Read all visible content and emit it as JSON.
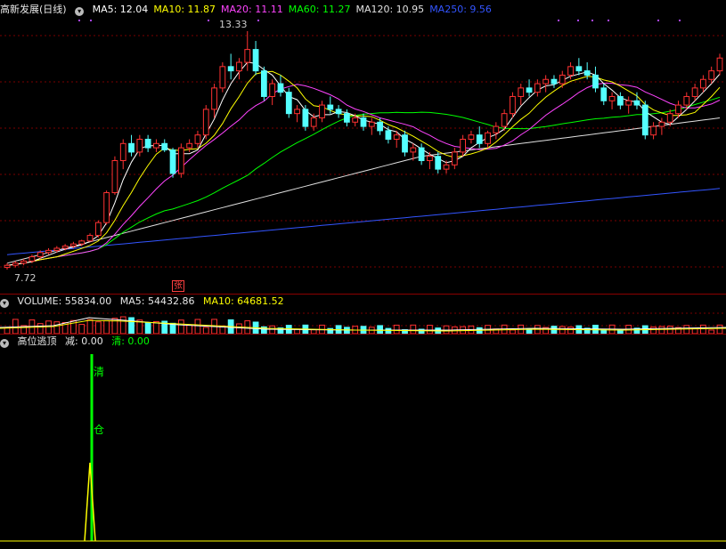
{
  "main": {
    "title": "高新发展(日线)",
    "ma": [
      {
        "label": "MA5: 12.04",
        "color": "#ffffff"
      },
      {
        "label": "MA10: 11.87",
        "color": "#ffff00"
      },
      {
        "label": "MA20: 11.11",
        "color": "#ff44ff"
      },
      {
        "label": "MA60: 11.27",
        "color": "#00ff00"
      },
      {
        "label": "MA120: 10.95",
        "color": "#e0e0e0"
      },
      {
        "label": "MA250: 9.56",
        "color": "#3355ff"
      }
    ],
    "high_label": "13.33",
    "low_label": "7.72",
    "zhang_label": "张"
  },
  "volume": {
    "title": "VOLUME: 55834.00",
    "ma5": "MA5: 54432.86",
    "ma10": "MA10: 64681.52"
  },
  "indicator": {
    "title": "高位逃顶",
    "jian": "减: 0.00",
    "qing": "清: 0.00",
    "qing_char": "清",
    "cang_char": "仓"
  },
  "colors": {
    "up": "#ff3232",
    "down": "#54ffff",
    "separator": "#8b0000"
  },
  "chart_data": {
    "type": "candlestick",
    "price_range": [
      7.72,
      13.33
    ],
    "candles": [
      [
        7.8,
        7.9,
        7.75,
        7.85
      ],
      [
        7.85,
        7.95,
        7.8,
        7.9
      ],
      [
        7.9,
        8.0,
        7.85,
        7.95
      ],
      [
        7.95,
        8.1,
        7.9,
        8.05
      ],
      [
        8.05,
        8.2,
        8.0,
        8.15
      ],
      [
        8.15,
        8.25,
        8.1,
        8.2
      ],
      [
        8.2,
        8.3,
        8.15,
        8.25
      ],
      [
        8.25,
        8.35,
        8.2,
        8.3
      ],
      [
        8.3,
        8.4,
        8.25,
        8.35
      ],
      [
        8.35,
        8.45,
        8.3,
        8.42
      ],
      [
        8.42,
        8.6,
        8.4,
        8.55
      ],
      [
        8.55,
        8.9,
        8.5,
        8.85
      ],
      [
        8.85,
        9.6,
        8.8,
        9.55
      ],
      [
        9.55,
        10.4,
        9.5,
        10.3
      ],
      [
        10.3,
        10.8,
        10.1,
        10.7
      ],
      [
        10.7,
        10.9,
        10.4,
        10.5
      ],
      [
        10.5,
        10.9,
        10.4,
        10.8
      ],
      [
        10.8,
        10.9,
        10.5,
        10.6
      ],
      [
        10.6,
        10.8,
        10.5,
        10.7
      ],
      [
        10.7,
        10.8,
        10.5,
        10.55
      ],
      [
        10.55,
        10.6,
        9.9,
        10.0
      ],
      [
        10.0,
        10.7,
        9.9,
        10.6
      ],
      [
        10.6,
        10.8,
        10.5,
        10.7
      ],
      [
        10.7,
        11.0,
        10.6,
        10.9
      ],
      [
        10.9,
        11.6,
        10.8,
        11.5
      ],
      [
        11.5,
        12.1,
        11.3,
        12.0
      ],
      [
        12.0,
        12.6,
        11.9,
        12.5
      ],
      [
        12.5,
        12.8,
        12.2,
        12.4
      ],
      [
        12.4,
        12.7,
        12.2,
        12.6
      ],
      [
        12.6,
        13.33,
        12.4,
        12.9
      ],
      [
        12.9,
        13.1,
        12.3,
        12.4
      ],
      [
        12.4,
        12.5,
        11.7,
        11.8
      ],
      [
        11.8,
        12.2,
        11.6,
        12.1
      ],
      [
        12.1,
        12.3,
        11.8,
        11.9
      ],
      [
        11.9,
        12.0,
        11.3,
        11.4
      ],
      [
        11.4,
        11.6,
        11.2,
        11.5
      ],
      [
        11.5,
        11.6,
        11.0,
        11.1
      ],
      [
        11.1,
        11.4,
        11.0,
        11.3
      ],
      [
        11.3,
        11.7,
        11.2,
        11.6
      ],
      [
        11.6,
        11.8,
        11.4,
        11.5
      ],
      [
        11.5,
        11.6,
        11.3,
        11.4
      ],
      [
        11.4,
        11.5,
        11.1,
        11.2
      ],
      [
        11.2,
        11.4,
        11.1,
        11.3
      ],
      [
        11.3,
        11.4,
        11.0,
        11.1
      ],
      [
        11.1,
        11.3,
        10.9,
        11.2
      ],
      [
        11.2,
        11.3,
        10.9,
        11.0
      ],
      [
        11.0,
        11.1,
        10.7,
        10.8
      ],
      [
        10.8,
        11.0,
        10.6,
        10.9
      ],
      [
        10.9,
        11.0,
        10.4,
        10.5
      ],
      [
        10.5,
        10.7,
        10.3,
        10.6
      ],
      [
        10.6,
        10.7,
        10.2,
        10.3
      ],
      [
        10.3,
        10.5,
        10.1,
        10.4
      ],
      [
        10.4,
        10.5,
        10.0,
        10.1
      ],
      [
        10.1,
        10.3,
        10.0,
        10.2
      ],
      [
        10.2,
        10.6,
        10.1,
        10.5
      ],
      [
        10.5,
        10.9,
        10.4,
        10.8
      ],
      [
        10.8,
        11.0,
        10.7,
        10.9
      ],
      [
        10.9,
        11.1,
        10.6,
        10.7
      ],
      [
        10.7,
        11.0,
        10.6,
        10.95
      ],
      [
        10.95,
        11.2,
        10.8,
        11.1
      ],
      [
        11.1,
        11.5,
        11.0,
        11.4
      ],
      [
        11.4,
        11.9,
        11.3,
        11.8
      ],
      [
        11.8,
        12.1,
        11.6,
        12.0
      ],
      [
        12.0,
        12.2,
        11.8,
        11.9
      ],
      [
        11.9,
        12.2,
        11.8,
        12.1
      ],
      [
        12.1,
        12.3,
        11.9,
        12.2
      ],
      [
        12.2,
        12.3,
        12.0,
        12.1
      ],
      [
        12.1,
        12.4,
        12.0,
        12.3
      ],
      [
        12.3,
        12.6,
        12.2,
        12.5
      ],
      [
        12.5,
        12.7,
        12.3,
        12.4
      ],
      [
        12.4,
        12.6,
        12.2,
        12.3
      ],
      [
        12.3,
        12.5,
        11.9,
        12.0
      ],
      [
        12.0,
        12.1,
        11.6,
        11.7
      ],
      [
        11.7,
        11.9,
        11.5,
        11.8
      ],
      [
        11.8,
        11.9,
        11.5,
        11.6
      ],
      [
        11.6,
        11.8,
        11.4,
        11.7
      ],
      [
        11.7,
        11.9,
        11.5,
        11.6
      ],
      [
        11.6,
        11.7,
        10.8,
        10.9
      ],
      [
        10.9,
        11.2,
        10.8,
        11.1
      ],
      [
        11.1,
        11.3,
        10.9,
        11.2
      ],
      [
        11.2,
        11.5,
        11.1,
        11.4
      ],
      [
        11.4,
        11.7,
        11.3,
        11.6
      ],
      [
        11.6,
        11.9,
        11.5,
        11.8
      ],
      [
        11.8,
        12.1,
        11.7,
        12.0
      ],
      [
        12.0,
        12.3,
        11.9,
        12.2
      ],
      [
        12.2,
        12.5,
        12.1,
        12.4
      ],
      [
        12.4,
        12.8,
        12.3,
        12.7
      ]
    ],
    "volume_ma5": 54432.86,
    "volume_ma10": 64681.52
  }
}
